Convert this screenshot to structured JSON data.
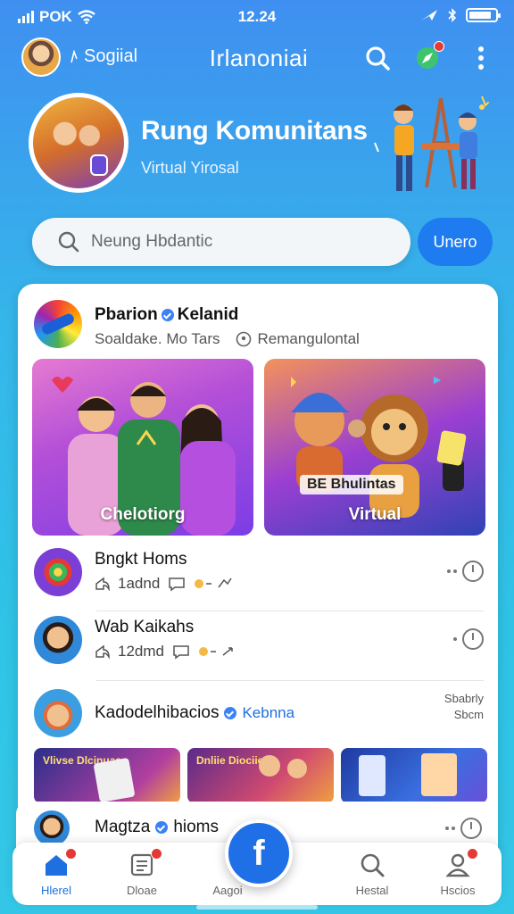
{
  "status_bar": {
    "carrier": "POK",
    "time": "12.24"
  },
  "topbar": {
    "username": "Sogiial",
    "title": "Irlanoniai"
  },
  "hero": {
    "title": "Rung Komunitans",
    "subtitle": "Virtual Yirosal"
  },
  "search": {
    "placeholder": "Neung Hbdantic",
    "button_label": "Unero"
  },
  "post": {
    "name": "Pbarion",
    "name_tag": "Kelanid",
    "meta_left": "Soaldake. Mo Tars",
    "meta_right": "Remangulontal",
    "media": [
      {
        "caption": "Chelotiorg"
      },
      {
        "banner": "BE Bhulintas",
        "caption": "Virtual"
      }
    ]
  },
  "list": [
    {
      "title": "Bngkt Homs",
      "count": "1adnd"
    },
    {
      "title": "Wab Kaikahs",
      "count": "12dmd"
    },
    {
      "title": "Kadodelhibacios",
      "tag": "Kebnna",
      "side_top": "Sbabrly",
      "side_bottom": "Sbcm"
    }
  ],
  "strip": [
    {
      "text": "Vlivse Dlcinuas"
    },
    {
      "text": "Dnliie Diociiedc"
    },
    {
      "text": ""
    }
  ],
  "peek": {
    "title": "Magtza",
    "tag": "hioms"
  },
  "fab_label": "f",
  "bottom_nav": [
    {
      "label": "Hlerel",
      "icon": "home-icon"
    },
    {
      "label": "Dloae",
      "icon": "news-icon"
    },
    {
      "label": "Aagoi",
      "icon": "add-icon"
    },
    {
      "label": "Hestal",
      "icon": "search-icon"
    },
    {
      "label": "Hscios",
      "icon": "profile-icon"
    }
  ],
  "colors": {
    "accent": "#1e7cf0",
    "badge": "#e53935",
    "background_top": "#3f8ff0",
    "background_bottom": "#34c6e6"
  }
}
